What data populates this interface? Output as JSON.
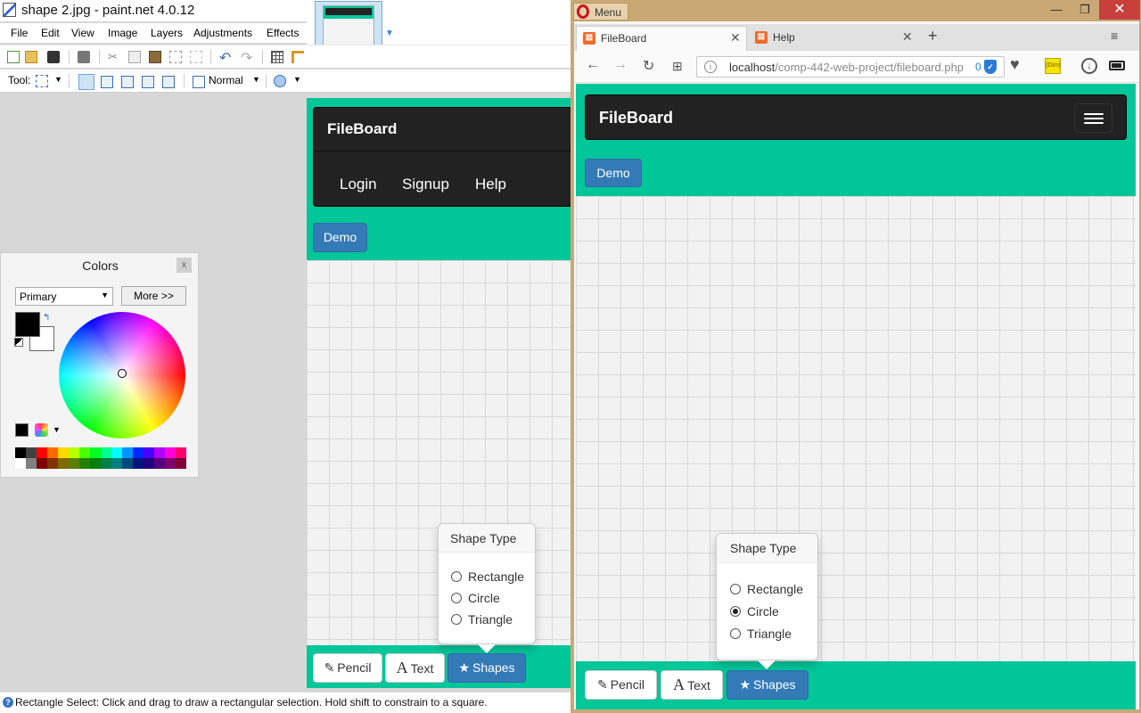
{
  "pdn": {
    "window_title": "shape 2.jpg - paint.net 4.0.12",
    "menu": [
      "File",
      "Edit",
      "View",
      "Image",
      "Layers",
      "Adjustments",
      "Effects"
    ],
    "tool_label": "Tool:",
    "blend_mode": "Normal",
    "status_text": "Rectangle Select: Click and drag to draw a rectangular selection. Hold shift to constrain to a square.",
    "colors_panel": {
      "title": "Colors",
      "close": "x",
      "selector": "Primary",
      "more_button": "More >>",
      "primary_color": "#000000",
      "secondary_color": "#ffffff",
      "palette_top": [
        "#000000",
        "#404040",
        "#ff0000",
        "#ff6a00",
        "#ffd800",
        "#b6ff00",
        "#4cff00",
        "#00ff21",
        "#00ff90",
        "#00ffff",
        "#0094ff",
        "#0026ff",
        "#4800ff",
        "#b200ff",
        "#ff00dc",
        "#ff006e"
      ],
      "palette_bottom": [
        "#ffffff",
        "#808080",
        "#7f0000",
        "#7f3300",
        "#7f6a00",
        "#5b7f00",
        "#267f00",
        "#007f0e",
        "#007f46",
        "#007f7f",
        "#004a7f",
        "#00137f",
        "#21007f",
        "#57007f",
        "#7f006e",
        "#7f0037"
      ]
    },
    "page": {
      "brand": "FileBoard",
      "nav_links": [
        "Login",
        "Signup",
        "Help"
      ],
      "demo_button": "Demo",
      "popover_title": "Shape Type",
      "options": [
        "Rectangle",
        "Circle",
        "Triangle"
      ],
      "toolbar": {
        "pencil": "Pencil",
        "text": "Text",
        "shapes": "Shapes"
      }
    }
  },
  "browser": {
    "menu_label": "Menu",
    "tabs": [
      {
        "title": "FileBoard",
        "active": true
      },
      {
        "title": "Help",
        "active": false
      }
    ],
    "url_host": "localhost",
    "url_path": "/comp-442-web-project/fileboard.php",
    "badge_count": "0",
    "page": {
      "brand": "FileBoard",
      "demo_button": "Demo",
      "popover_title": "Shape Type",
      "options": [
        "Rectangle",
        "Circle",
        "Triangle"
      ],
      "selected_option": "Circle",
      "toolbar": {
        "pencil": "Pencil",
        "text": "Text",
        "shapes": "Shapes"
      }
    }
  },
  "colors": {
    "accent_green": "#00c699",
    "navbar": "#222222",
    "primary_blue": "#337ab7"
  }
}
